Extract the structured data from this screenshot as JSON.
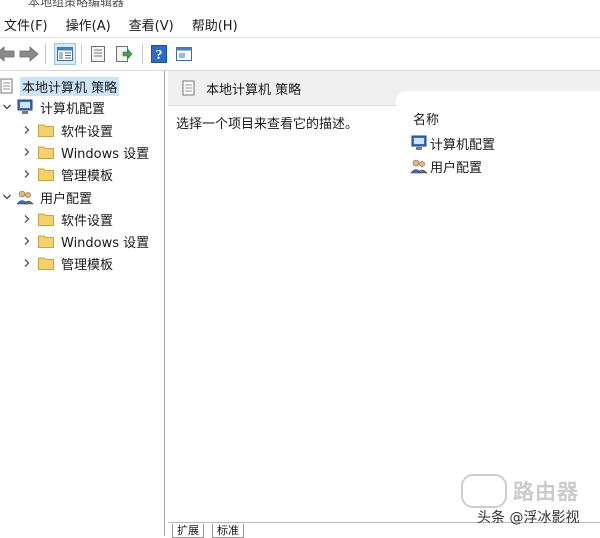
{
  "window": {
    "title": "本地组策略编辑器"
  },
  "menu": [
    {
      "label": "文件(F)"
    },
    {
      "label": "操作(A)"
    },
    {
      "label": "查看(V)"
    },
    {
      "label": "帮助(H)"
    }
  ],
  "tree": {
    "root": {
      "label": "本地计算机 策略"
    },
    "computer": {
      "label": "计算机配置",
      "children": [
        {
          "label": "软件设置"
        },
        {
          "label": "Windows 设置"
        },
        {
          "label": "管理模板"
        }
      ]
    },
    "user": {
      "label": "用户配置",
      "children": [
        {
          "label": "软件设置"
        },
        {
          "label": "Windows 设置"
        },
        {
          "label": "管理模板"
        }
      ]
    }
  },
  "content": {
    "header": "本地计算机 策略",
    "description": "选择一个项目来查看它的描述。",
    "column_name": "名称",
    "items": [
      {
        "label": "计算机配置"
      },
      {
        "label": "用户配置"
      }
    ]
  },
  "tabs": [
    {
      "label": "扩展"
    },
    {
      "label": "标准"
    }
  ],
  "watermark": {
    "brand": "路由器",
    "credit": "头条 @浮冰影视"
  },
  "colors": {
    "selection": "#cce4f7",
    "folder": "#f4d06f",
    "help_icon": "#2d6cc6"
  }
}
